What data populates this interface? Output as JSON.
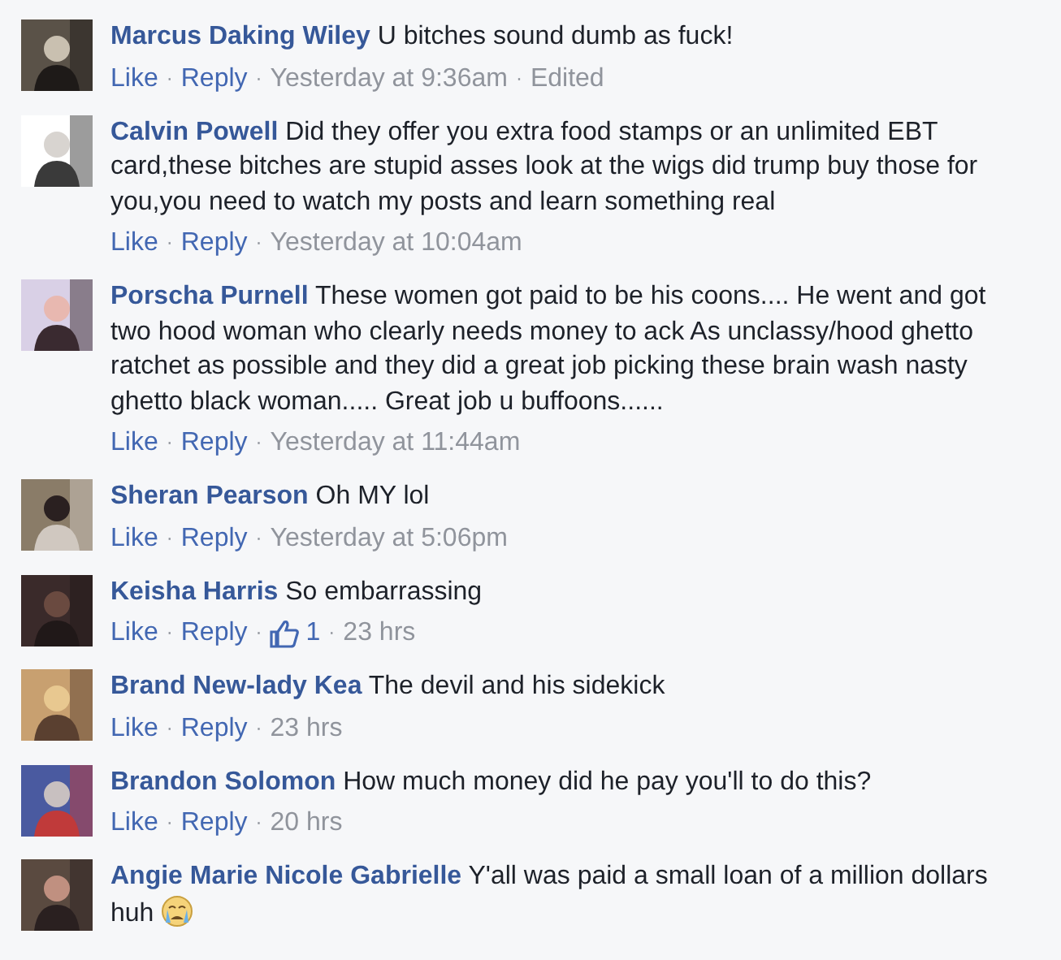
{
  "separator": "·",
  "comments": [
    {
      "name": "Marcus Daking Wiley",
      "text": "U bitches sound dumb as fuck!",
      "actions": [
        "Like",
        "Reply"
      ],
      "time": "Yesterday at 9:36am",
      "edited": "Edited"
    },
    {
      "name": "Calvin Powell",
      "text": "Did they offer you extra food stamps or an unlimited EBT card,these bitches are stupid asses look at the wigs did trump buy those for you,you need to watch my posts and learn something real",
      "actions": [
        "Like",
        "Reply"
      ],
      "time": "Yesterday at 10:04am"
    },
    {
      "name": "Porscha Purnell",
      "text": "These women got paid to be his coons.... He went and got two hood woman who clearly needs money to ack As unclassy/hood ghetto ratchet as possible and they did a great job picking these brain wash nasty ghetto black woman..... Great job u buffoons......",
      "actions": [
        "Like",
        "Reply"
      ],
      "time": "Yesterday at 11:44am"
    },
    {
      "name": "Sheran Pearson",
      "text": "Oh MY lol",
      "actions": [
        "Like",
        "Reply"
      ],
      "time": "Yesterday at 5:06pm"
    },
    {
      "name": "Keisha Harris",
      "text": "So embarrassing",
      "actions": [
        "Like",
        "Reply"
      ],
      "likes": "1",
      "time": "23 hrs"
    },
    {
      "name": "Brand New-lady Kea",
      "text": "The devil and his sidekick",
      "actions": [
        "Like",
        "Reply"
      ],
      "time": "23 hrs"
    },
    {
      "name": "Brandon Solomon",
      "text": "How much money did he pay you'll to do this?",
      "actions": [
        "Like",
        "Reply"
      ],
      "time": "20 hrs"
    },
    {
      "name": "Angie Marie Nicole Gabrielle",
      "text": "Y'all was paid a small loan of a million dollars huh",
      "trailing_emoji": true
    }
  ]
}
